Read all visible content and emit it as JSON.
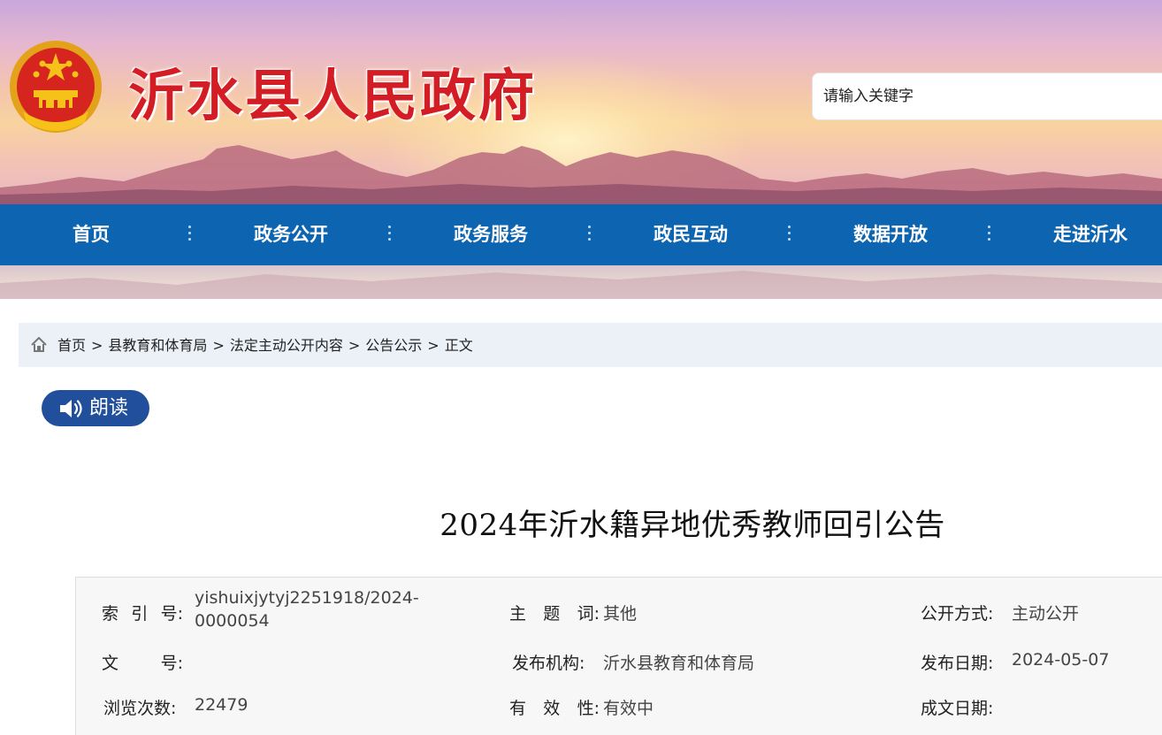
{
  "header": {
    "site_title": "沂水县人民政府",
    "search_placeholder": "请输入关键字",
    "emblem_icon": "national-emblem-icon",
    "brand_red": "#d31c24"
  },
  "nav": {
    "color": "#0d65b1",
    "items": [
      "首页",
      "政务公开",
      "政务服务",
      "政民互动",
      "数据开放",
      "走进沂水"
    ]
  },
  "breadcrumb": {
    "icon": "home-icon",
    "items": [
      "首页",
      "县教育和体育局",
      "法定主动公开内容",
      "公告公示",
      "正文"
    ],
    "separator": ">"
  },
  "read_button": {
    "label": "朗读",
    "icon": "speaker-icon"
  },
  "article": {
    "title": "2024年沂水籍异地优秀教师回引公告"
  },
  "meta": {
    "index_label": "索引号:",
    "index_value_line1": "yishuixjytyj2251918/2024-",
    "index_value_line2": "0000054",
    "subject_label": "主题词:",
    "subject_value": "其他",
    "disclosure_label": "公开方式:",
    "disclosure_value": "主动公开",
    "docno_label": "文号:",
    "docno_value": "",
    "issuer_label": "发布机构:",
    "issuer_value": "沂水县教育和体育局",
    "publish_date_label": "发布日期:",
    "publish_date_value": "2024-05-07",
    "views_label": "浏览次数:",
    "views_value": "22479",
    "validity_label": "有效性:",
    "validity_value": "有效中",
    "written_date_label": "成文日期:",
    "written_date_value": ""
  }
}
